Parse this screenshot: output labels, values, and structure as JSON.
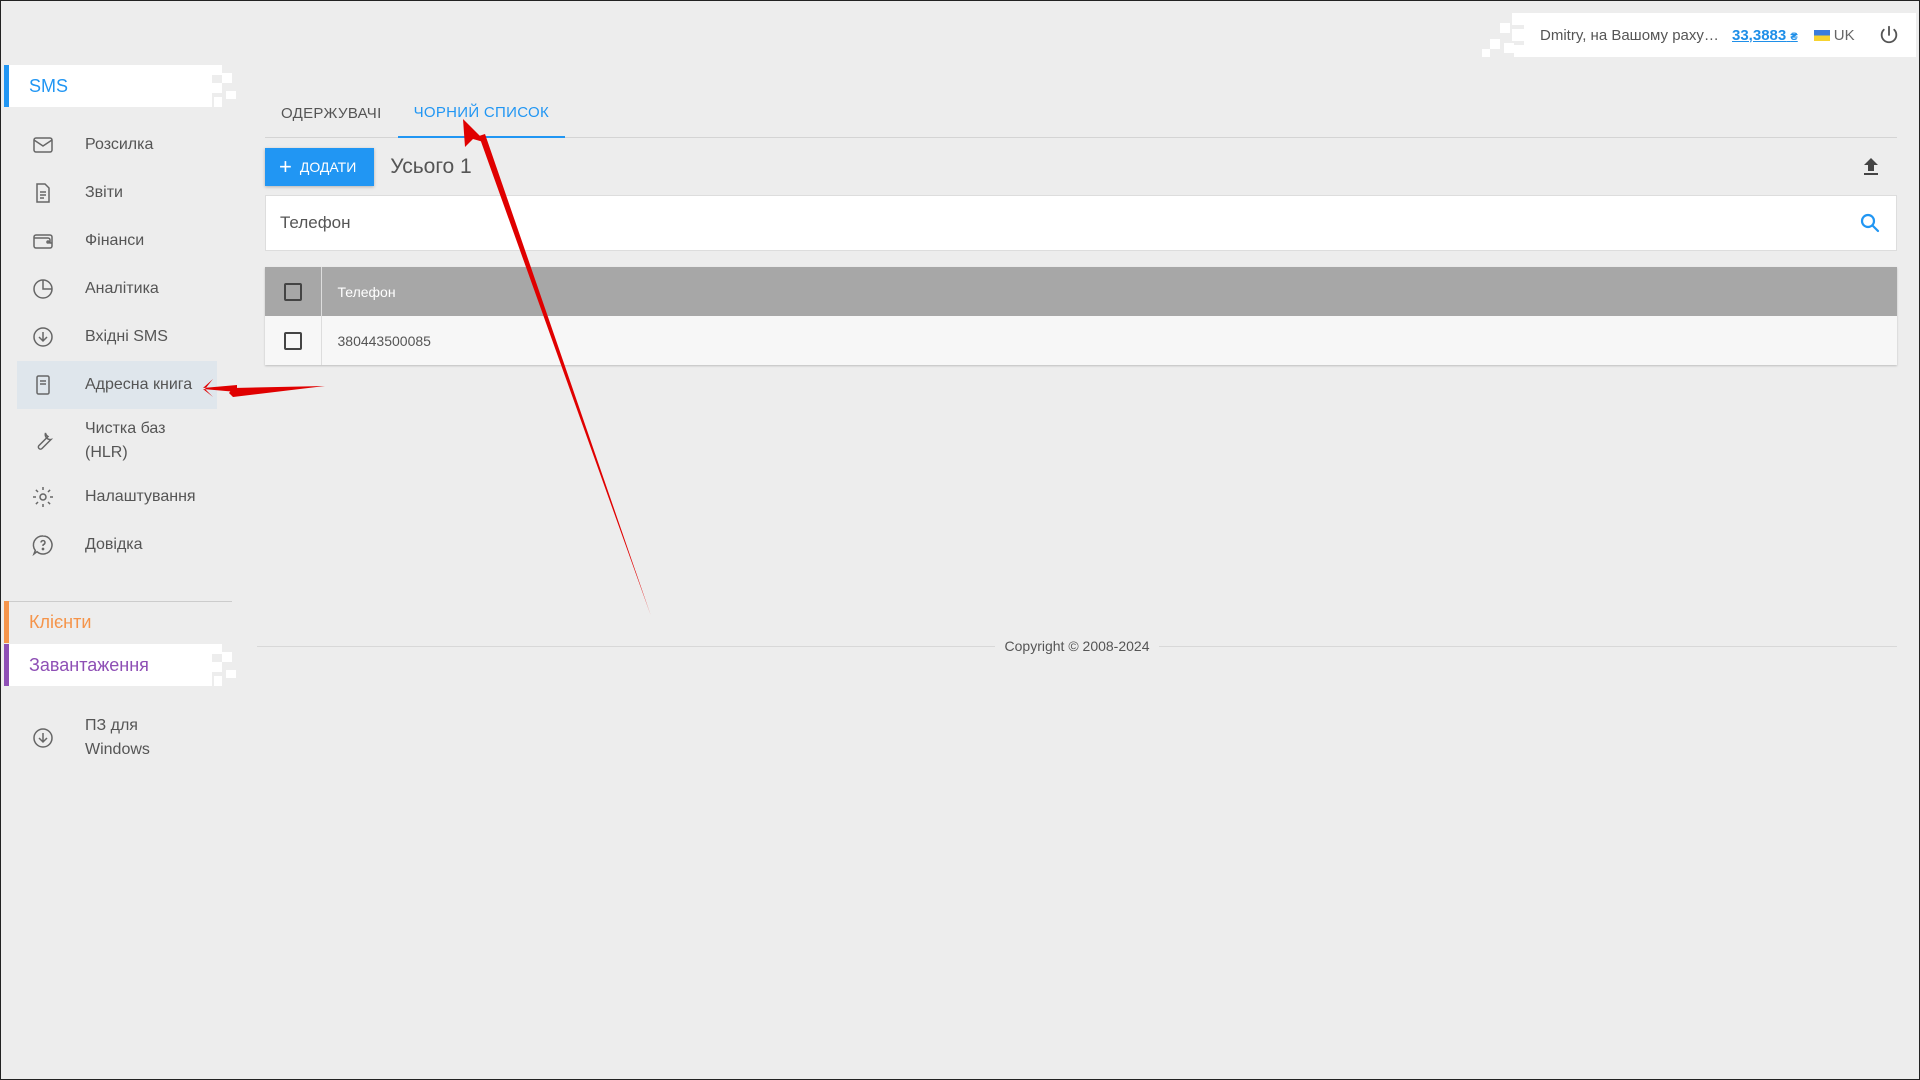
{
  "userbar": {
    "greeting": "Dmitry, на Вашому рахунку",
    "balance": "33,3883",
    "currency": "₴",
    "lang": "UK"
  },
  "sidebar": {
    "sms_section": "SMS",
    "items": [
      {
        "label": "Розсилка",
        "icon": "envelope-icon"
      },
      {
        "label": "Звіти",
        "icon": "document-icon"
      },
      {
        "label": "Фінанси",
        "icon": "wallet-icon"
      },
      {
        "label": "Аналітика",
        "icon": "pie-chart-icon"
      },
      {
        "label": "Вхідні SMS",
        "icon": "download-circle-icon"
      },
      {
        "label": "Адресна книга",
        "icon": "book-icon"
      },
      {
        "label": "Чистка баз (HLR)",
        "icon": "wrench-icon"
      },
      {
        "label": "Налаштування",
        "icon": "gear-icon"
      },
      {
        "label": "Довідка",
        "icon": "help-icon"
      }
    ],
    "clients_section": "Клієнти",
    "downloads_section": "Завантаження",
    "downloads_items": [
      {
        "label": "ПЗ для Windows",
        "icon": "download-circle-icon"
      }
    ]
  },
  "tabs": [
    {
      "label": "ОДЕРЖУВАЧІ",
      "active": false
    },
    {
      "label": "ЧОРНИЙ СПИСОК",
      "active": true
    }
  ],
  "toolbar": {
    "add_label": "ДОДАТИ",
    "total": "Усього 1"
  },
  "search": {
    "placeholder": "Телефон"
  },
  "table": {
    "columns": [
      "Телефон"
    ],
    "rows": [
      {
        "phone": "380443500085"
      }
    ]
  },
  "footer": {
    "copyright": "Copyright © 2008-2024"
  },
  "colors": {
    "accent": "#2196f3",
    "clients": "#f5944a",
    "downloads": "#8e4fb5",
    "annotation": "#e00000"
  }
}
